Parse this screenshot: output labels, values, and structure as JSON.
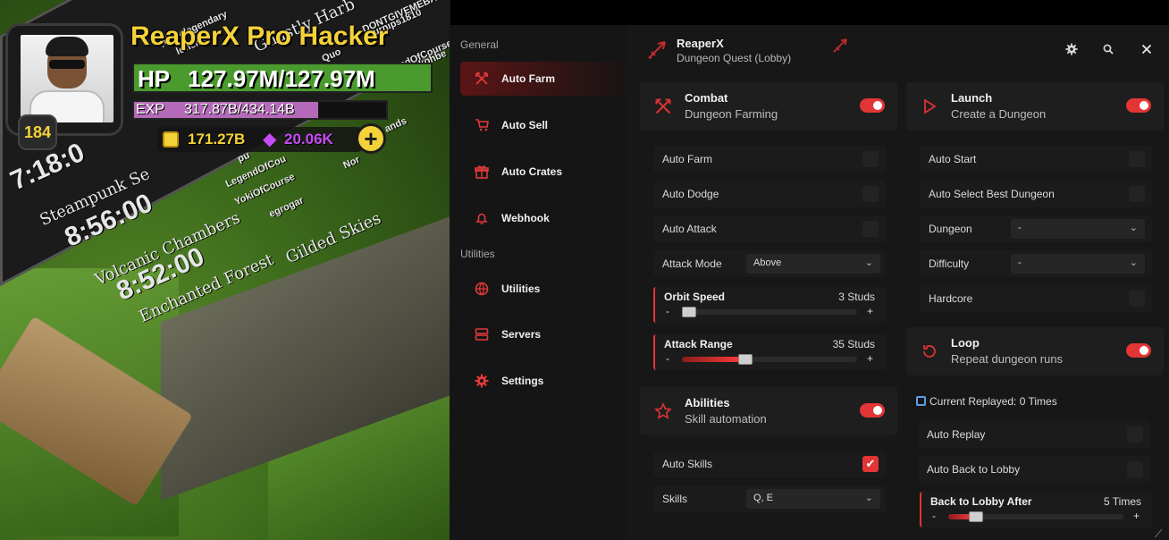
{
  "hud": {
    "name": "ReaperX Pro Hacker",
    "level": "184",
    "hp_label": "HP",
    "hp_value": "127.97M/127.97M",
    "hp_fraction": 1.0,
    "exp_label": "EXP",
    "exp_value": "317.87B/434.14B",
    "exp_fraction": 0.73,
    "gold": "171.27B",
    "gems": "20.06K",
    "plus": "+"
  },
  "scene_signs": [
    {
      "text": "7:18:0",
      "cls": "big"
    },
    {
      "text": "Steampunk Se",
      "cls": "mid"
    },
    {
      "text": "8:56:00",
      "cls": "big"
    },
    {
      "text": "Volcanic Chambers",
      "cls": "mid"
    },
    {
      "text": "8:52:00",
      "cls": "big"
    },
    {
      "text": "Enchanted Forest",
      "cls": "mid"
    },
    {
      "text": "Ghastly Harb",
      "cls": "mid"
    },
    {
      "text": "turnips1810",
      "cls": "sm"
    },
    {
      "text": "LegendOfCourse",
      "cls": "sm"
    },
    {
      "text": "YokiOfCourse",
      "cls": "sm"
    },
    {
      "text": "egrogar",
      "cls": "sm"
    },
    {
      "text": "Gilded Skies",
      "cls": "mid"
    },
    {
      "text": "Nor",
      "cls": "sm"
    },
    {
      "text": "ands",
      "cls": "sm"
    },
    {
      "text": "ping4legendary",
      "cls": "sm"
    },
    {
      "text": "lohen36",
      "cls": "sm"
    },
    {
      "text": "DONTGIVEMEBAD",
      "cls": "sm"
    },
    {
      "text": "kohbe",
      "cls": "sm"
    },
    {
      "text": "Quo",
      "cls": "sm"
    },
    {
      "text": "pu",
      "cls": "sm"
    },
    {
      "text": "LegendOfCou",
      "cls": "sm"
    }
  ],
  "sidebar": {
    "general_label": "General",
    "utilities_label": "Utilities",
    "items": [
      {
        "label": "Auto Farm",
        "icon": "crossed-swords-icon",
        "active": true
      },
      {
        "label": "Auto Sell",
        "icon": "cart-icon"
      },
      {
        "label": "Auto Crates",
        "icon": "gift-icon"
      },
      {
        "label": "Webhook",
        "icon": "bell-icon"
      },
      {
        "label": "Utilities",
        "icon": "globe-icon"
      },
      {
        "label": "Servers",
        "icon": "server-icon"
      },
      {
        "label": "Settings",
        "icon": "gear-icon"
      }
    ]
  },
  "titlebar": {
    "name": "ReaperX",
    "subtitle": "Dungeon Quest (Lobby)"
  },
  "left": {
    "combat": {
      "title": "Combat",
      "subtitle": "Dungeon Farming",
      "enabled": true
    },
    "auto_farm": "Auto Farm",
    "auto_dodge": "Auto Dodge",
    "auto_attack": "Auto Attack",
    "attack_mode_label": "Attack Mode",
    "attack_mode_value": "Above",
    "orbit_speed": {
      "label": "Orbit Speed",
      "value": "3 Studs",
      "fraction": 0.02
    },
    "attack_range": {
      "label": "Attack Range",
      "value": "35 Studs",
      "fraction": 0.35
    },
    "abilities": {
      "title": "Abilities",
      "subtitle": "Skill automation",
      "enabled": true
    },
    "auto_skills": "Auto Skills",
    "auto_skills_checked": true,
    "skills_label": "Skills",
    "skills_value": "Q, E"
  },
  "right": {
    "launch": {
      "title": "Launch",
      "subtitle": "Create a Dungeon",
      "enabled": true
    },
    "auto_start": "Auto Start",
    "auto_select": "Auto Select Best Dungeon",
    "dungeon_label": "Dungeon",
    "dungeon_value": "-",
    "difficulty_label": "Difficulty",
    "difficulty_value": "-",
    "hardcore": "Hardcore",
    "loop": {
      "title": "Loop",
      "subtitle": "Repeat dungeon runs",
      "enabled": true
    },
    "current_replayed": "Current Replayed: 0 Times",
    "auto_replay": "Auto Replay",
    "auto_back": "Auto Back to Lobby",
    "back_after": {
      "label": "Back to Lobby After",
      "value": "5 Times",
      "fraction": 0.15
    }
  },
  "colors": {
    "accent": "#e23535",
    "panel": "#141414",
    "gold": "#f4d23a",
    "gem": "#c54bf5",
    "hp": "#4a9a2e",
    "exp": "#b46ab8"
  }
}
